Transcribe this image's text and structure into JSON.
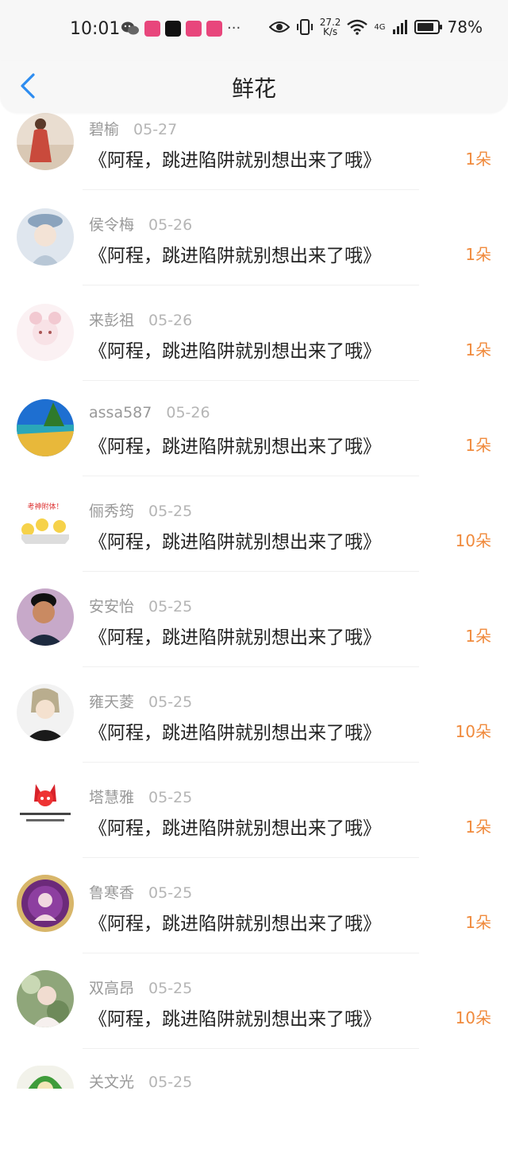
{
  "status_bar": {
    "time": "10:01",
    "more": "···",
    "speed_top": "27.2",
    "speed_bottom": "K/s",
    "network": "4G",
    "battery": "78%"
  },
  "nav": {
    "title": "鲜花"
  },
  "items": [
    {
      "name": "碧榆",
      "date": "05-27",
      "title": "《阿程，跳进陷阱就别想出来了哦》",
      "count": "1朵"
    },
    {
      "name": "侯令梅",
      "date": "05-26",
      "title": "《阿程，跳进陷阱就别想出来了哦》",
      "count": "1朵"
    },
    {
      "name": "来彭祖",
      "date": "05-26",
      "title": "《阿程，跳进陷阱就别想出来了哦》",
      "count": "1朵"
    },
    {
      "name": "assa587",
      "date": "05-26",
      "title": "《阿程，跳进陷阱就别想出来了哦》",
      "count": "1朵"
    },
    {
      "name": "俪秀筠",
      "date": "05-25",
      "title": "《阿程，跳进陷阱就别想出来了哦》",
      "count": "10朵",
      "avatar_text": "考神附体！"
    },
    {
      "name": "安安怡",
      "date": "05-25",
      "title": "《阿程，跳进陷阱就别想出来了哦》",
      "count": "1朵"
    },
    {
      "name": "雍天菱",
      "date": "05-25",
      "title": "《阿程，跳进陷阱就别想出来了哦》",
      "count": "10朵"
    },
    {
      "name": "塔慧雅",
      "date": "05-25",
      "title": "《阿程，跳进陷阱就别想出来了哦》",
      "count": "1朵"
    },
    {
      "name": "鲁寒香",
      "date": "05-25",
      "title": "《阿程，跳进陷阱就别想出来了哦》",
      "count": "1朵"
    },
    {
      "name": "双高昂",
      "date": "05-25",
      "title": "《阿程，跳进陷阱就别想出来了哦》",
      "count": "10朵"
    },
    {
      "name": "关文光",
      "date": "05-25",
      "title": "",
      "count": ""
    }
  ],
  "colors": {
    "accent_back": "#2d8cf0",
    "count": "#f08a3c",
    "name": "#999999",
    "date": "#b5b5b5"
  }
}
